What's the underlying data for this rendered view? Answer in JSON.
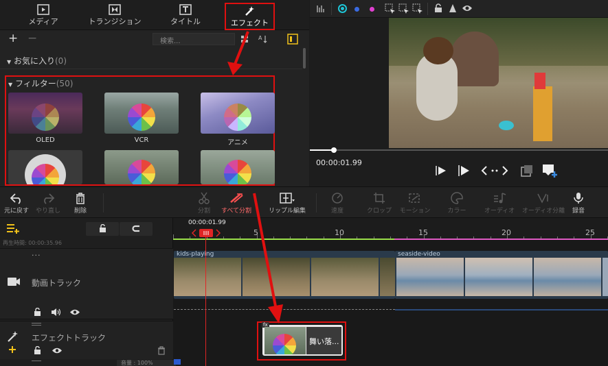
{
  "tabs": [
    {
      "label": "メディア",
      "icon": "media-icon"
    },
    {
      "label": "トランジション",
      "icon": "transition-icon"
    },
    {
      "label": "タイトル",
      "icon": "title-icon"
    },
    {
      "label": "エフェクト",
      "icon": "effect-wand-icon"
    }
  ],
  "library": {
    "search_placeholder": "検索...",
    "favorites": {
      "label": "お気に入り",
      "count": "(0)"
    },
    "filters": {
      "label": "フィルター",
      "count": "(50)"
    },
    "thumbs": [
      {
        "label": "OLED"
      },
      {
        "label": "VCR"
      },
      {
        "label": "アニメ"
      },
      {
        "label": ""
      },
      {
        "label": ""
      },
      {
        "label": ""
      }
    ]
  },
  "preview": {
    "timecode": "00:00:01.99",
    "progress_fraction": 0.08
  },
  "edit_toolbar": [
    {
      "label": "元に戻す",
      "icon": "undo-icon",
      "enabled": true
    },
    {
      "label": "やり直し",
      "icon": "redo-icon",
      "enabled": false
    },
    {
      "label": "削除",
      "icon": "trash-icon",
      "enabled": true
    },
    {
      "label": "分割",
      "icon": "scissors-icon",
      "enabled": false
    },
    {
      "label": "すべて分割",
      "icon": "split-all-icon",
      "enabled": true
    },
    {
      "label": "リップル編集",
      "icon": "ripple-edit-icon",
      "enabled": true
    },
    {
      "label": "速度",
      "icon": "speed-icon",
      "enabled": false
    },
    {
      "label": "クロップ",
      "icon": "crop-icon",
      "enabled": false
    },
    {
      "label": "モーション",
      "icon": "motion-icon",
      "enabled": false
    },
    {
      "label": "カラー",
      "icon": "color-icon",
      "enabled": false
    },
    {
      "label": "オーディオ",
      "icon": "audio-icon",
      "enabled": false
    },
    {
      "label": "オーディオ分離",
      "icon": "audio-detach-icon",
      "enabled": false
    },
    {
      "label": "録音",
      "icon": "mic-icon",
      "enabled": true
    }
  ],
  "timeline": {
    "playhead_time": "00:00:01.99",
    "duration_label": "再生時間:",
    "duration_value": "00:00:35.96",
    "ruler_ticks": [
      "5",
      "10",
      "15",
      "20",
      "25"
    ],
    "video_track": {
      "label": "動画トラック",
      "more": "..."
    },
    "effect_track": {
      "label": "エフェクトトラック"
    },
    "volume_label": "音量 : 100%",
    "clips": [
      {
        "label": "kids-playing"
      },
      {
        "label": "seaside-video"
      }
    ],
    "effect_clip": {
      "label": "舞い落...",
      "badge": "fx"
    }
  },
  "colors": {
    "highlight_red": "#e01010",
    "accent_yellow": "#f2c21a",
    "ruler_green": "#9be04a",
    "ruler_pink": "#e05ac4",
    "playhead_red": "#e02525"
  }
}
